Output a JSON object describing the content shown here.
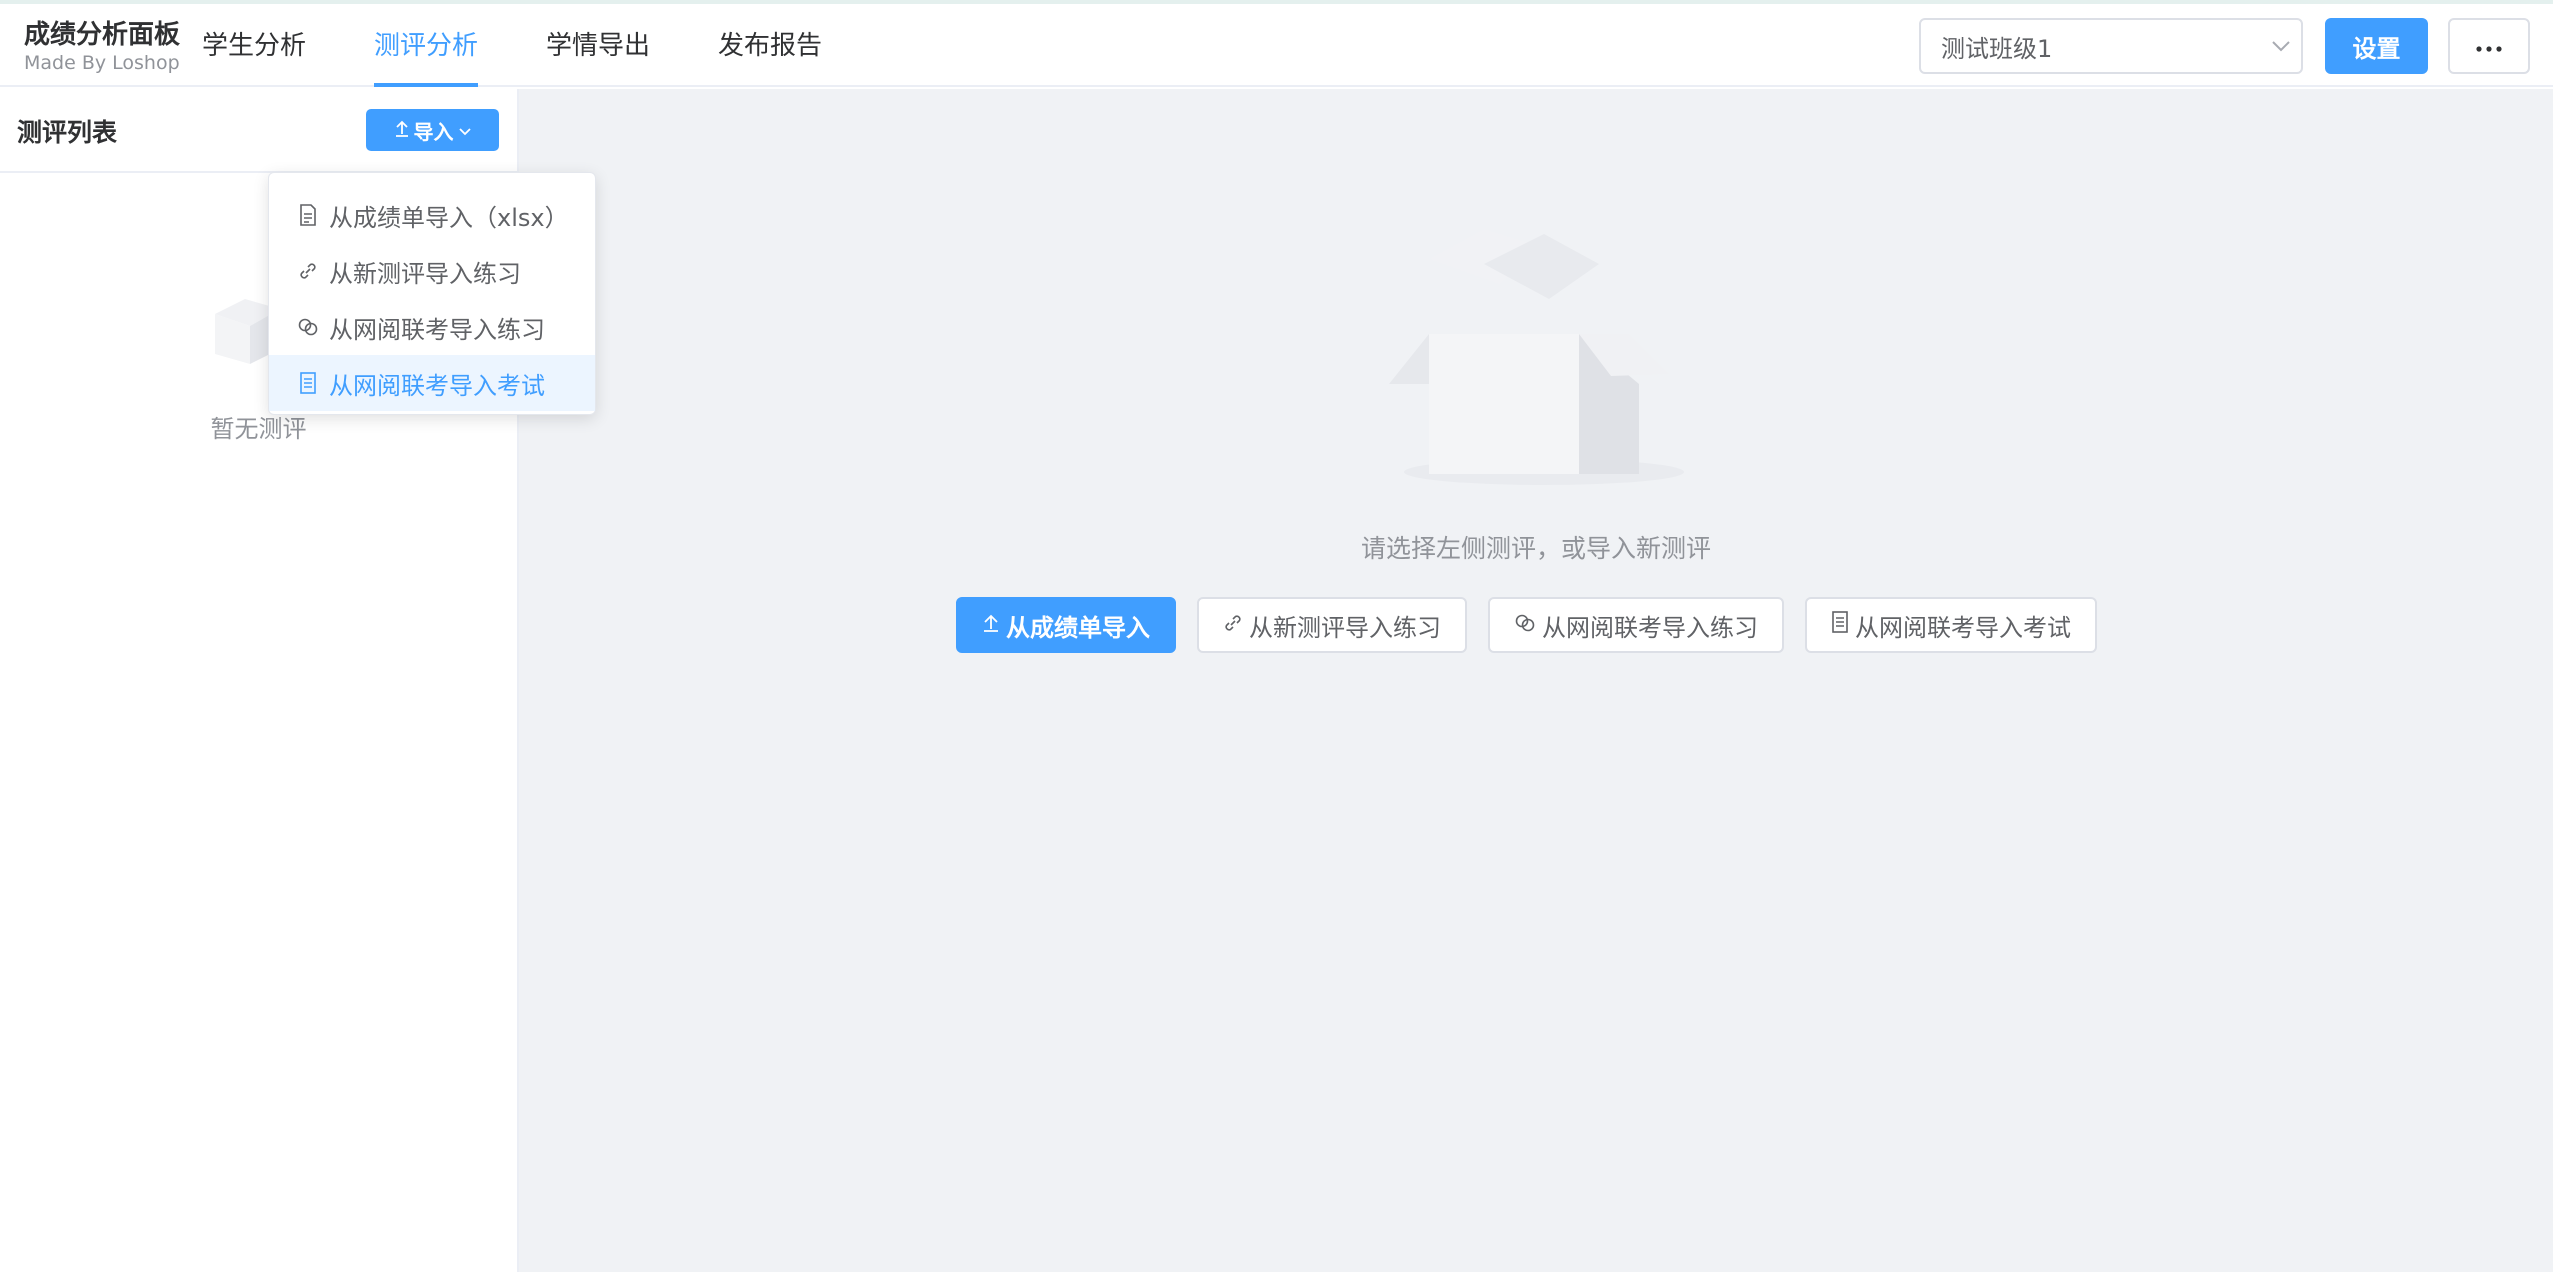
{
  "brand": {
    "title": "成绩分析面板",
    "subtitle": "Made By Loshop"
  },
  "nav": {
    "items": [
      {
        "label": "学生分析",
        "active": false
      },
      {
        "label": "测评分析",
        "active": true
      },
      {
        "label": "学情导出",
        "active": false
      },
      {
        "label": "发布报告",
        "active": false
      }
    ]
  },
  "header": {
    "class_select": {
      "value": "测试班级1",
      "icon": "chevron-down-icon"
    },
    "settings_label": "设置",
    "more_icon": "more-dots-icon"
  },
  "sidebar": {
    "title": "测评列表",
    "import_button": {
      "label": "导入",
      "icon": "upload-icon",
      "caret": "chevron-down-icon"
    },
    "empty_text": "暂无测评",
    "dropdown": {
      "items": [
        {
          "label": "从成绩单导入（xlsx）",
          "icon": "document-icon",
          "hover": false
        },
        {
          "label": "从新测评导入练习",
          "icon": "link-icon",
          "hover": false
        },
        {
          "label": "从网阅联考导入练习",
          "icon": "connection-icon",
          "hover": false
        },
        {
          "label": "从网阅联考导入考试",
          "icon": "tickets-icon",
          "hover": true
        }
      ]
    }
  },
  "main": {
    "empty_text": "请选择左侧测评，或导入新测评",
    "actions": [
      {
        "label": "从成绩单导入",
        "icon": "upload-icon",
        "primary": true
      },
      {
        "label": "从新测评导入练习",
        "icon": "link-icon",
        "primary": false
      },
      {
        "label": "从网阅联考导入练习",
        "icon": "connection-icon",
        "primary": false
      },
      {
        "label": "从网阅联考导入考试",
        "icon": "tickets-icon",
        "primary": false
      }
    ]
  },
  "colors": {
    "primary": "#409eff",
    "hover_bg": "#ecf5ff",
    "main_bg": "#f0f2f5",
    "border": "#dcdfe6"
  }
}
